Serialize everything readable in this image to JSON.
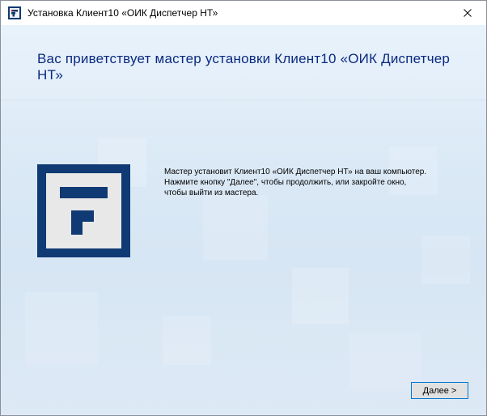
{
  "window": {
    "title": "Установка Клиент10 «ОИК Диспетчер НТ»",
    "close_glyph": "✕",
    "app_icon": "installer-app-icon"
  },
  "header": {
    "title": "Вас приветствует мастер установки Клиент10 «ОИК Диспетчер НТ»"
  },
  "body": {
    "logo_icon": "company-logo-icon",
    "description_lines": [
      "Мастер установит Клиент10 «ОИК Диспетчер НТ» на ваш компьютер.",
      "Нажмите кнопку \"Далее\", чтобы продолжить, или закройте окно,",
      "чтобы выйти из мастера."
    ]
  },
  "footer": {
    "next_label": "Далее >"
  },
  "colors": {
    "title_text": "#0a2a80",
    "logo_navy": "#103a73",
    "button_focus_border": "#0078d7"
  }
}
